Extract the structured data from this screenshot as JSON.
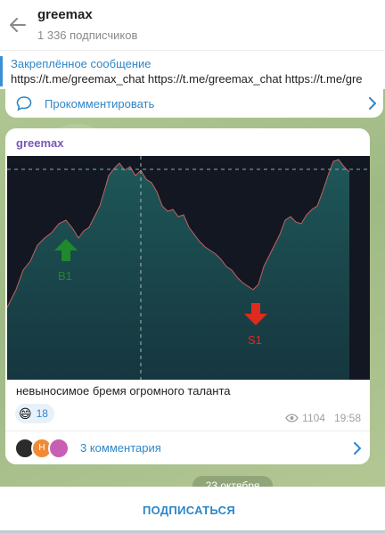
{
  "header": {
    "title": "greemax",
    "subtitle": "1 336 подписчиков"
  },
  "pinned": {
    "title": "Закреплённое сообщение",
    "text": "https://t.me/greemax_chat https://t.me/greemax_chat https://t.me/gre"
  },
  "prev_post": {
    "comment_label": "Прокомментировать"
  },
  "post": {
    "author": "greemax",
    "caption": "невыносимое бремя огромного таланта",
    "reaction_emoji": "😄",
    "reaction_count": "18",
    "views": "1104",
    "time": "19:58",
    "comments_label": "3 комментария",
    "avatar_letter": "H"
  },
  "chart_image": {
    "label_b1": "B1",
    "label_s1": "S1"
  },
  "date_label": "23 октября",
  "footer": {
    "subscribe_label": "ПОДПИСАТЬСЯ"
  },
  "colors": {
    "accent": "#2f86c8",
    "author": "#7a55b8",
    "buy": "#1f8a2b",
    "sell": "#e12a1f"
  }
}
